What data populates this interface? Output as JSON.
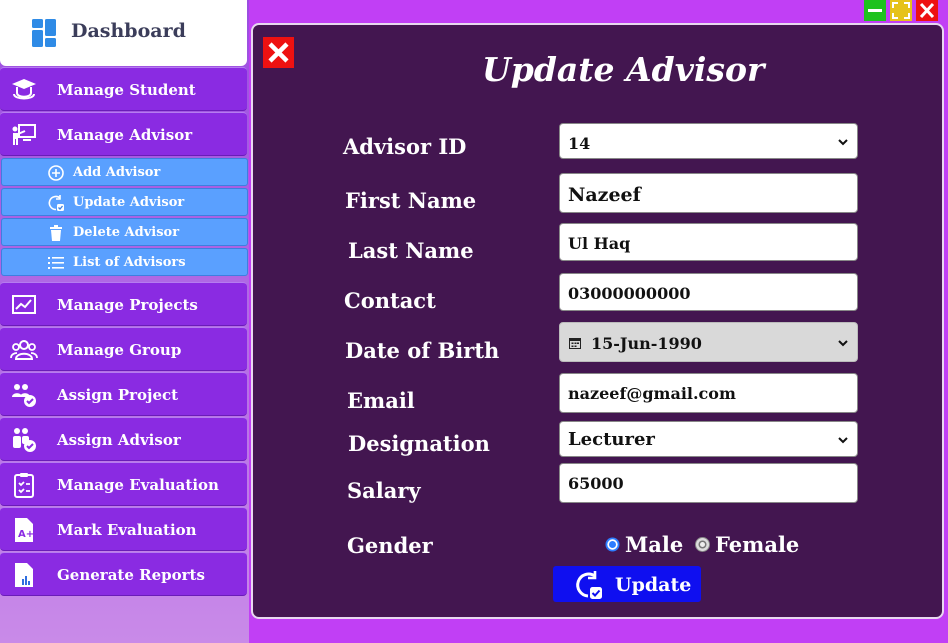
{
  "sidebar": {
    "title": "Dashboard",
    "items": [
      {
        "label": "Manage Student",
        "icon": "graduate-icon"
      },
      {
        "label": "Manage Advisor",
        "icon": "teacher-board-icon"
      },
      {
        "label": "Manage Projects",
        "icon": "chart-board-icon"
      },
      {
        "label": "Manage Group",
        "icon": "group-icon"
      },
      {
        "label": "Assign Project",
        "icon": "assign-users-icon"
      },
      {
        "label": "Assign Advisor",
        "icon": "assign-advisor-icon"
      },
      {
        "label": "Manage Evaluation",
        "icon": "clipboard-check-icon"
      },
      {
        "label": "Mark Evaluation",
        "icon": "grade-file-icon"
      },
      {
        "label": "Generate Reports",
        "icon": "report-file-icon"
      }
    ],
    "subitems": [
      {
        "label": "Add Advisor",
        "icon": "plus-circle-icon"
      },
      {
        "label": "Update Advisor",
        "icon": "refresh-check-icon"
      },
      {
        "label": "Delete Advisor",
        "icon": "trash-icon"
      },
      {
        "label": "List of Advisors",
        "icon": "list-icon"
      }
    ]
  },
  "form": {
    "title": "Update Advisor",
    "labels": {
      "advisor_id": "Advisor ID",
      "first_name": "First Name",
      "last_name": "Last Name",
      "contact": "Contact",
      "dob": "Date of Birth",
      "email": "Email",
      "designation": "Designation",
      "salary": "Salary",
      "gender": "Gender"
    },
    "values": {
      "advisor_id": "14",
      "first_name": "Nazeef",
      "last_name": "Ul Haq",
      "contact": "03000000000",
      "dob": "15-Jun-1990",
      "email": "nazeef@gmail.com",
      "designation": "Lecturer",
      "salary": "65000"
    },
    "gender_options": {
      "male": "Male",
      "female": "Female",
      "selected": "male"
    },
    "update_label": "Update"
  },
  "colors": {
    "background": "#c13ff5",
    "panel": "#431650",
    "sidebar_item": "#8a2be2",
    "sub_item": "#5aa0ff",
    "update_button": "#0f0ff0",
    "close": "#ee1111"
  }
}
